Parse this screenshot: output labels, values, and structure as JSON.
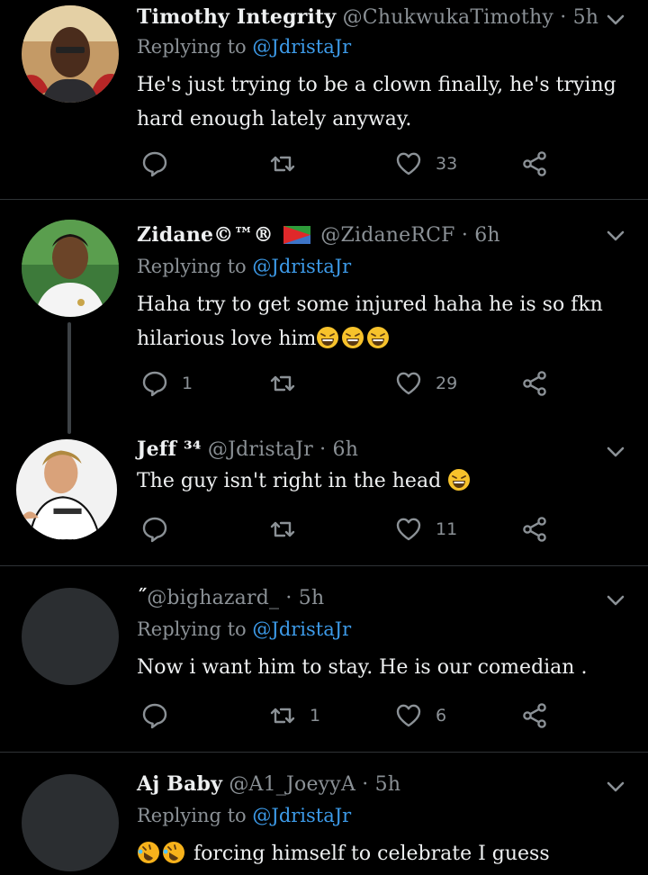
{
  "tweets": [
    {
      "name": "Timothy Integrity",
      "handle": "@ChukwukaTimothy",
      "time": "· 5h",
      "replying_prefix": "Replying to",
      "replying_handle": "@JdristaJr",
      "text": "He's just trying to be a clown finally, he's trying hard enough lately anyway.",
      "reply_count": "",
      "retweet_count": "",
      "like_count": "33"
    },
    {
      "name": "Zidane©™®",
      "handle": "@ZidaneRCF",
      "time": "· 6h",
      "replying_prefix": "Replying to",
      "replying_handle": "@JdristaJr",
      "text": "Haha try to get some injured haha he is so fkn hilarious love him",
      "reply_count": "1",
      "retweet_count": "",
      "like_count": "29"
    },
    {
      "name": "Jeff ³⁴",
      "handle": "@JdristaJr",
      "time": "· 6h",
      "text": "The guy isn't right in the head",
      "reply_count": "",
      "retweet_count": "",
      "like_count": "11"
    },
    {
      "name": "˝",
      "handle": "@bighazard_",
      "time": "· 5h",
      "replying_prefix": "Replying to",
      "replying_handle": "@JdristaJr",
      "text": "Now i want him to stay. He is our comedian .",
      "reply_count": "",
      "retweet_count": "1",
      "like_count": "6"
    },
    {
      "name": "Aj Baby",
      "handle": "@A1_JoeyyA",
      "time": "· 5h",
      "replying_prefix": "Replying to",
      "replying_handle": "@JdristaJr",
      "text": "forcing himself to celebrate I guess",
      "reply_count": "",
      "retweet_count": "",
      "like_count": ""
    }
  ],
  "colors": {
    "link": "#3d9be9",
    "muted": "#8b9196",
    "divider": "#2f3336"
  },
  "icons": [
    "reply-icon",
    "retweet-icon",
    "like-icon",
    "share-icon",
    "chevron-down-icon",
    "eritrea-flag-icon",
    "laughing-emoji-icon",
    "rofl-emoji-icon"
  ]
}
